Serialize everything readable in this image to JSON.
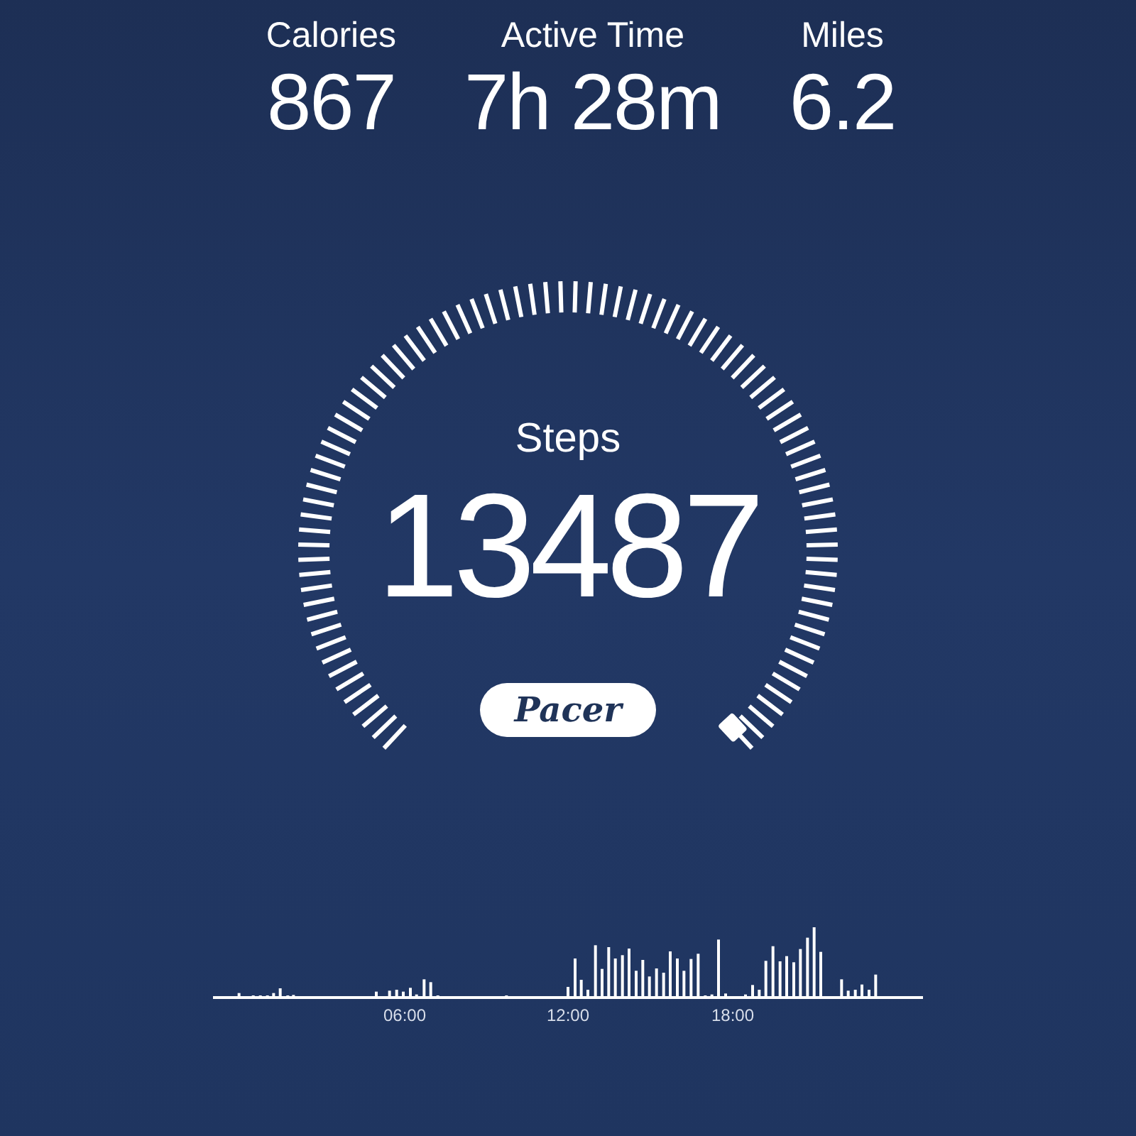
{
  "stats": [
    {
      "label": "Calories",
      "value": "867"
    },
    {
      "label": "Active Time",
      "value": "7h 28m"
    },
    {
      "label": "Miles",
      "value": "6.2"
    }
  ],
  "gauge": {
    "label": "Steps",
    "value": "13487"
  },
  "brand": "Pacer",
  "activity_chart": {
    "time_labels": [
      "06:00",
      "12:00",
      "18:00"
    ]
  }
}
